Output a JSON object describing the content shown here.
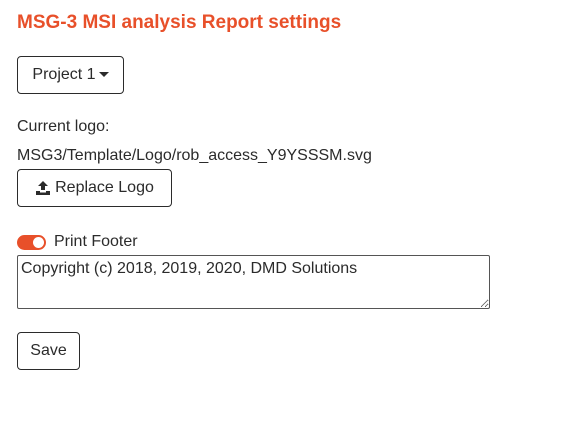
{
  "page": {
    "title": "MSG-3 MSI analysis Report settings"
  },
  "project_dropdown": {
    "selected": "Project 1"
  },
  "logo": {
    "label": "Current logo:",
    "path": "MSG3/Template/Logo/rob_access_Y9YSSSM.svg",
    "replace_label": "Replace Logo",
    "replace_icon": "upload-icon"
  },
  "footer": {
    "toggle_on": true,
    "label": "Print Footer",
    "text": "Copyright (c) 2018, 2019, 2020, DMD Solutions"
  },
  "actions": {
    "save_label": "Save"
  },
  "colors": {
    "accent": "#e8502a",
    "text": "#2b2b2b",
    "border": "#2b2b2b"
  }
}
